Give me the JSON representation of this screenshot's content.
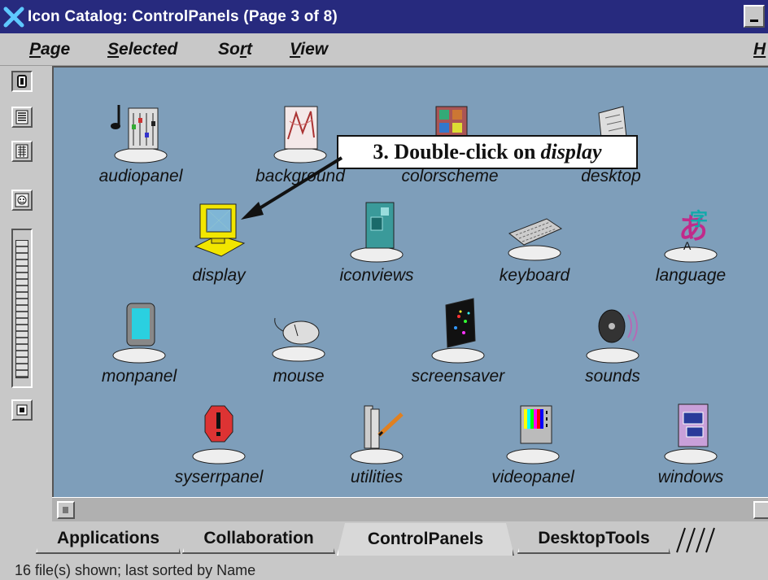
{
  "window": {
    "title": "Icon Catalog: ControlPanels (Page 3 of 8)"
  },
  "menubar": {
    "items": [
      {
        "label": "Page",
        "mnemonic": "P"
      },
      {
        "label": "Selected",
        "mnemonic": "S"
      },
      {
        "label": "Sort",
        "mnemonic": "r"
      },
      {
        "label": "View",
        "mnemonic": "V"
      },
      {
        "label": "H",
        "mnemonic": "H"
      }
    ]
  },
  "icons": [
    {
      "label": "audiopanel",
      "icon": "audiopanel-icon"
    },
    {
      "label": "background",
      "icon": "background-icon"
    },
    {
      "label": "colorscheme",
      "icon": "colorscheme-icon"
    },
    {
      "label": "desktop",
      "icon": "desktop-icon"
    },
    {
      "label": "display",
      "icon": "display-icon"
    },
    {
      "label": "iconviews",
      "icon": "iconviews-icon"
    },
    {
      "label": "keyboard",
      "icon": "keyboard-icon"
    },
    {
      "label": "language",
      "icon": "language-icon"
    },
    {
      "label": "monpanel",
      "icon": "monpanel-icon"
    },
    {
      "label": "mouse",
      "icon": "mouse-icon"
    },
    {
      "label": "screensaver",
      "icon": "screensaver-icon"
    },
    {
      "label": "sounds",
      "icon": "sounds-icon"
    },
    {
      "label": "syserrpanel",
      "icon": "syserrpanel-icon"
    },
    {
      "label": "utilities",
      "icon": "utilities-icon"
    },
    {
      "label": "videopanel",
      "icon": "videopanel-icon"
    },
    {
      "label": "windows",
      "icon": "windows-icon"
    }
  ],
  "callout": {
    "prefix": "3.  Double-click on",
    "target": "display"
  },
  "tabs": [
    {
      "label": "Applications",
      "active": false
    },
    {
      "label": "Collaboration",
      "active": false
    },
    {
      "label": "ControlPanels",
      "active": true
    },
    {
      "label": "DesktopTools",
      "active": false
    }
  ],
  "status": {
    "text": "16 file(s) shown; last sorted by Name"
  },
  "colors": {
    "titlebar": "#272a7e",
    "viewport": "#7e9eba",
    "chrome": "#c8c8c8"
  }
}
